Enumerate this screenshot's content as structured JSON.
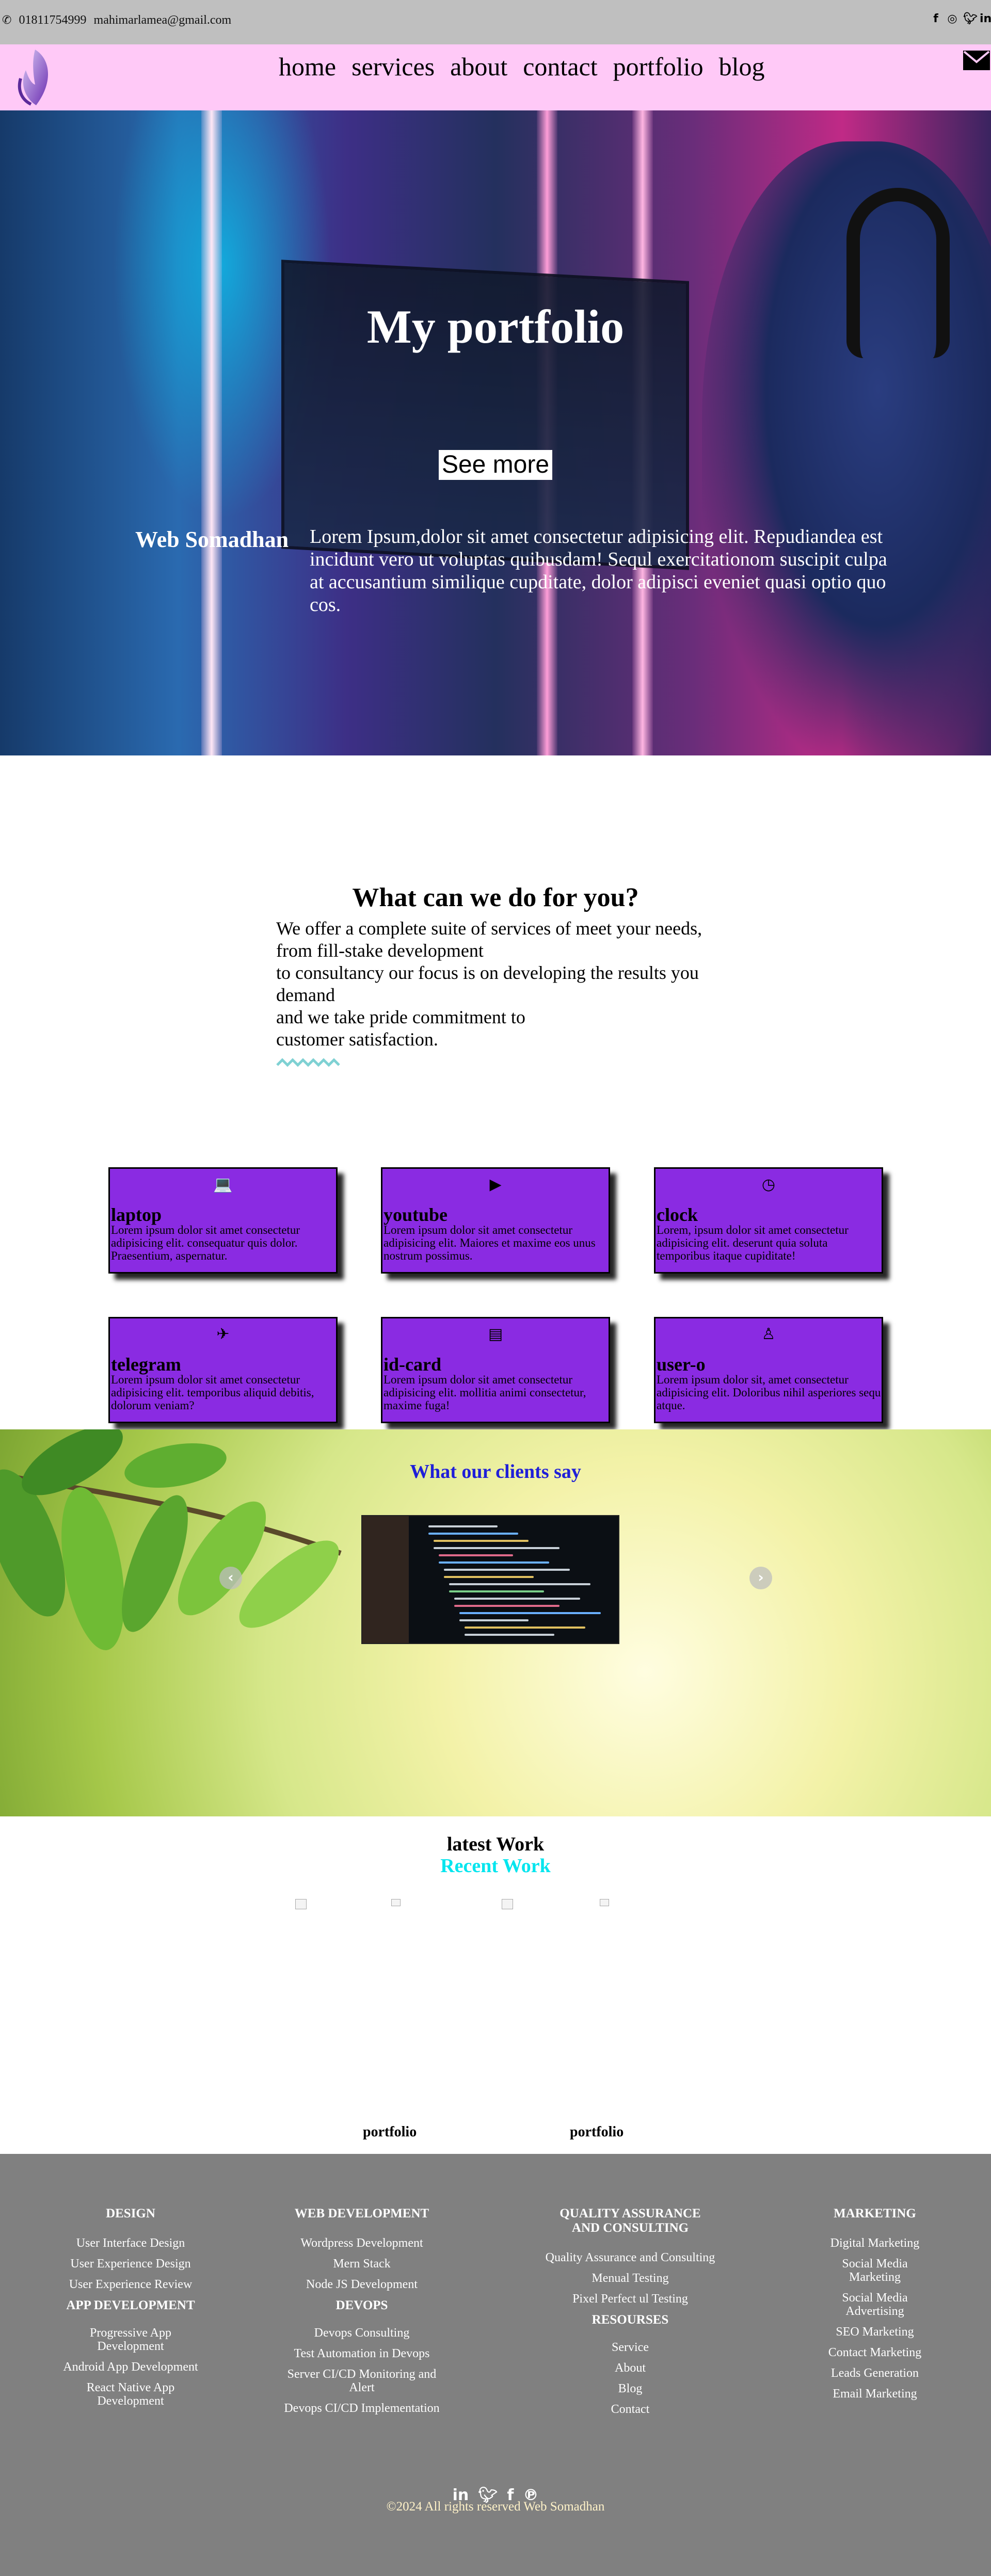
{
  "topbar": {
    "phone": "01811754999",
    "email": "mahimarlamea@gmail.com",
    "social_icons": [
      "facebook-icon",
      "instagram-icon",
      "twitter-icon",
      "linkedin-icon"
    ]
  },
  "nav": {
    "items": [
      "home",
      "services",
      "about",
      "contact",
      "portfolio",
      "blog"
    ]
  },
  "hero": {
    "title": "My portfolio",
    "button": "See more",
    "brand": "Web Somadhan",
    "text": "Lorem Ipsum,dolor sit amet consectetur adipisicing elit. Repudiandea est incidunt vero ut voluptas quibusdam! Sequl exercitationom suscipit culpa at accusantium similique cupditate, dolor adipisci eveniet quasi optio quo cos."
  },
  "services": {
    "title": "What can we do for you?",
    "lines": [
      "We offer a complete suite of services of meet your needs,",
      "from fill-stake development",
      "to consultancy our focus is on developing the results you demand",
      "and we take pride commitment to",
      "customer satisfaction."
    ],
    "cards": [
      {
        "icon": "laptop-icon",
        "glyph": "💻",
        "title": "laptop",
        "text": "Lorem ipsum dolor sit amet consectetur adipisicing elit. consequatur quis dolor. Praesentium, aspernatur."
      },
      {
        "icon": "youtube-icon",
        "glyph": "▶",
        "title": "youtube",
        "text": "Lorem ipsum dolor sit amet consectetur adipisicing elit. Maiores et maxime eos unus nostrum possimus."
      },
      {
        "icon": "clock-icon",
        "glyph": "◷",
        "title": "clock",
        "text": "Lorem, ipsum dolor sit amet consectetur adipisicing elit. deserunt quia soluta temporibus itaque cupiditate!"
      },
      {
        "icon": "telegram-icon",
        "glyph": "✈",
        "title": "telegram",
        "text": "Lorem ipsum dolor sit amet consectetur adipisicing elit. temporibus aliquid debitis, dolorum veniam?"
      },
      {
        "icon": "id-card-icon",
        "glyph": "▤",
        "title": "id-card",
        "text": "Lorem ipsum dolor sit amet consectetur adipisicing elit. mollitia animi consectetur, maxime fuga!"
      },
      {
        "icon": "user-icon",
        "glyph": "♙",
        "title": "user-o",
        "text": "Lorem ipsum dolor sit, amet consectetur adipisicing elit. Doloribus nihil asperiores sequ atque."
      }
    ]
  },
  "testimonials": {
    "title": "What our clients say",
    "prev": "‹",
    "next": "›"
  },
  "latest_work": {
    "title": "latest Work",
    "subtitle": "Recent Work",
    "labels": [
      "portfolio",
      "portfolio"
    ]
  },
  "footer": {
    "columns": [
      {
        "heading": "DESIGN",
        "items": [
          "User Interface Design",
          "User Experience Design",
          "User Experience Review"
        ],
        "sub_heading": "APP DEVELOPMENT",
        "sub_items": [
          "Progressive App Development",
          "Android App Development",
          "React Native App Development"
        ]
      },
      {
        "heading": "WEB DEVELOPMENT",
        "items": [
          "Wordpress Development",
          "Mern Stack",
          "Node JS Development"
        ],
        "sub_heading": "DEVOPS",
        "sub_items": [
          "Devops Consulting",
          "Test Automation in Devops",
          "Server CI/CD Monitoring and Alert",
          "Devops CI/CD Implementation"
        ]
      },
      {
        "heading": "QUALITY ASSURANCE AND CONSULTING",
        "items": [
          "Quality Assurance and Consulting",
          "Menual Testing",
          "Pixel Perfect ul Testing"
        ],
        "sub_heading": "RESOURSES",
        "sub_items": [
          "Service",
          "About",
          "Blog",
          "Contact"
        ]
      },
      {
        "heading": "MARKETING",
        "items": [
          "Digital Marketing",
          "Social Media Marketing",
          "Social Media Advertising",
          "SEO Marketing",
          "Contact Marketing",
          "Leads Generation",
          "Email Marketing"
        ],
        "sub_heading": "",
        "sub_items": []
      }
    ],
    "social_icons": [
      "linkedin-icon",
      "twitter-icon",
      "facebook-icon",
      "pinterest-icon"
    ],
    "copyright": "©2024 All rights reserved Web Somadhan"
  }
}
